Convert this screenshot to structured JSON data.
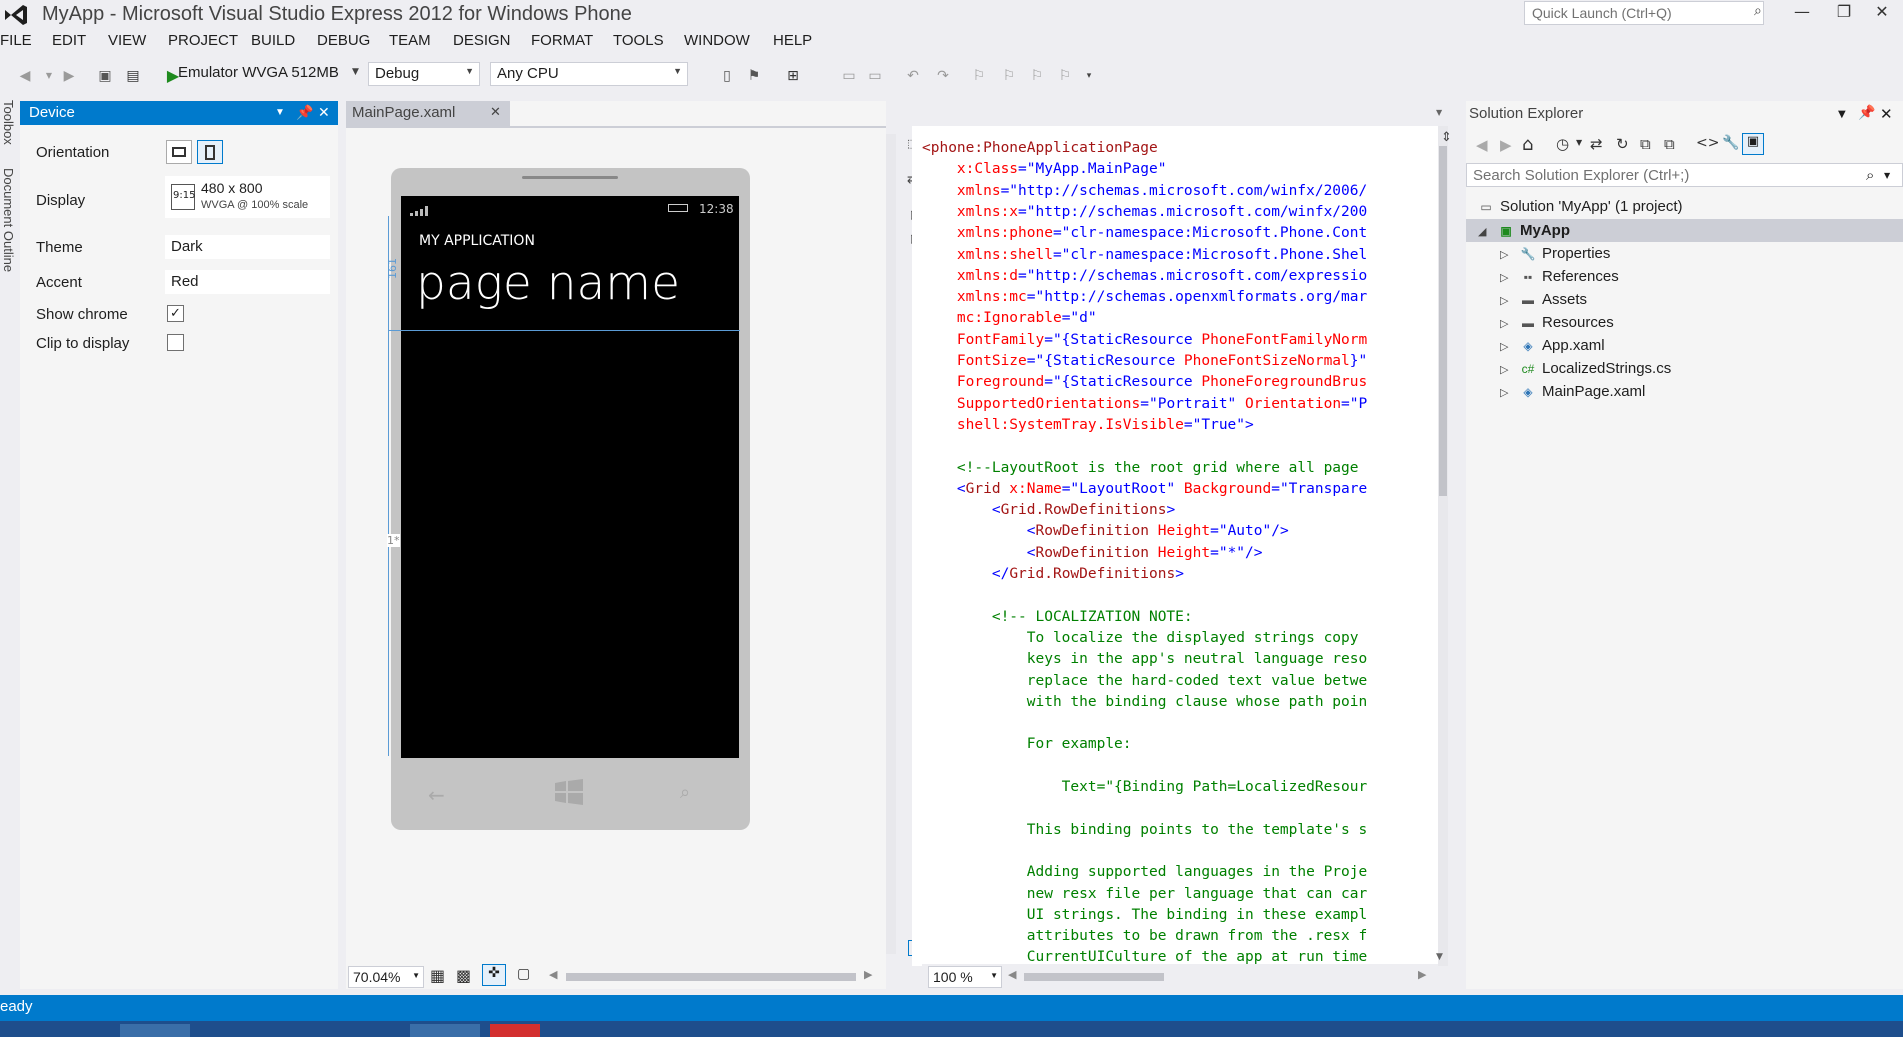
{
  "window": {
    "title": "MyApp - Microsoft Visual Studio Express 2012 for Windows Phone",
    "quick_launch_placeholder": "Quick Launch (Ctrl+Q)"
  },
  "menu": [
    "FILE",
    "EDIT",
    "VIEW",
    "PROJECT",
    "BUILD",
    "DEBUG",
    "TEAM",
    "DESIGN",
    "FORMAT",
    "TOOLS",
    "WINDOW",
    "HELP"
  ],
  "toolbar": {
    "run_target": "Emulator WVGA 512MB",
    "configuration": "Debug",
    "platform": "Any CPU"
  },
  "vertical_tabs": [
    "Toolbox",
    "Document Outline"
  ],
  "device_panel": {
    "title": "Device",
    "orientation_label": "Orientation",
    "display_label": "Display",
    "display_icon_text": "9:15",
    "display_value": "480 x 800",
    "display_sub": "WVGA @ 100% scale",
    "theme_label": "Theme",
    "theme_value": "Dark",
    "accent_label": "Accent",
    "accent_value": "Red",
    "show_chrome_label": "Show chrome",
    "show_chrome_checked": "✓",
    "clip_label": "Clip to display"
  },
  "designer": {
    "tab_label": "MainPage.xaml",
    "phone_time": "12:38",
    "app_name": "MY APPLICATION",
    "page_name": "page name",
    "row_marker_1": "161",
    "row_marker_2": "1*",
    "zoom": "70.04%"
  },
  "editor": {
    "zoom": "100 %",
    "lines": [
      [
        [
          "kw",
          "<phone:PhoneApplicationPage"
        ]
      ],
      [
        [
          "at",
          "    x:Class"
        ],
        [
          "vl",
          "=\"MyApp.MainPage\""
        ]
      ],
      [
        [
          "at",
          "    xmlns"
        ],
        [
          "vl",
          "=\"http://schemas.microsoft.com/winfx/2006/"
        ]
      ],
      [
        [
          "at",
          "    xmlns:x"
        ],
        [
          "vl",
          "=\"http://schemas.microsoft.com/winfx/200"
        ]
      ],
      [
        [
          "at",
          "    xmlns:phone"
        ],
        [
          "vl",
          "=\"clr-namespace:Microsoft.Phone.Cont"
        ]
      ],
      [
        [
          "at",
          "    xmlns:shell"
        ],
        [
          "vl",
          "=\"clr-namespace:Microsoft.Phone.Shel"
        ]
      ],
      [
        [
          "at",
          "    xmlns:d"
        ],
        [
          "vl",
          "=\"http://schemas.microsoft.com/expressio"
        ]
      ],
      [
        [
          "at",
          "    xmlns:mc"
        ],
        [
          "vl",
          "=\"http://schemas.openxmlformats.org/mar"
        ]
      ],
      [
        [
          "at",
          "    mc:Ignorable"
        ],
        [
          "vl",
          "=\"d\""
        ]
      ],
      [
        [
          "at",
          "    FontFamily"
        ],
        [
          "vl",
          "=\"{StaticResource "
        ],
        [
          "at",
          "PhoneFontFamilyNorm"
        ]
      ],
      [
        [
          "at",
          "    FontSize"
        ],
        [
          "vl",
          "=\"{StaticResource "
        ],
        [
          "at",
          "PhoneFontSizeNormal"
        ],
        [
          "vl",
          "}\""
        ]
      ],
      [
        [
          "at",
          "    Foreground"
        ],
        [
          "vl",
          "=\"{StaticResource "
        ],
        [
          "at",
          "PhoneForegroundBrus"
        ]
      ],
      [
        [
          "at",
          "    SupportedOrientations"
        ],
        [
          "vl",
          "=\"Portrait\" "
        ],
        [
          "at",
          "Orientation"
        ],
        [
          "vl",
          "=\"P"
        ]
      ],
      [
        [
          "at",
          "    shell:SystemTray.IsVisible"
        ],
        [
          "vl",
          "=\"True\">"
        ]
      ],
      [
        [
          "vl",
          ""
        ]
      ],
      [
        [
          "cm",
          "    <!--LayoutRoot is the root grid where all page"
        ]
      ],
      [
        [
          "vl",
          "    <"
        ],
        [
          "kw",
          "Grid"
        ],
        [
          "at",
          " x:Name"
        ],
        [
          "vl",
          "=\"LayoutRoot\" "
        ],
        [
          "at",
          "Background"
        ],
        [
          "vl",
          "=\"Transpare"
        ]
      ],
      [
        [
          "vl",
          "        <"
        ],
        [
          "kw",
          "Grid.RowDefinitions"
        ],
        [
          "vl",
          ">"
        ]
      ],
      [
        [
          "vl",
          "            <"
        ],
        [
          "kw",
          "RowDefinition"
        ],
        [
          "at",
          " Height"
        ],
        [
          "vl",
          "=\"Auto\"/>"
        ]
      ],
      [
        [
          "vl",
          "            <"
        ],
        [
          "kw",
          "RowDefinition"
        ],
        [
          "at",
          " Height"
        ],
        [
          "vl",
          "=\"*\"/>"
        ]
      ],
      [
        [
          "vl",
          "        </"
        ],
        [
          "kw",
          "Grid.RowDefinitions"
        ],
        [
          "vl",
          ">"
        ]
      ],
      [
        [
          "vl",
          ""
        ]
      ],
      [
        [
          "cm",
          "        <!-- LOCALIZATION NOTE:"
        ]
      ],
      [
        [
          "cm",
          "            To localize the displayed strings copy"
        ]
      ],
      [
        [
          "cm",
          "            keys in the app's neutral language reso"
        ]
      ],
      [
        [
          "cm",
          "            replace the hard-coded text value betwe"
        ]
      ],
      [
        [
          "cm",
          "            with the binding clause whose path poin"
        ]
      ],
      [
        [
          "vl",
          ""
        ]
      ],
      [
        [
          "cm",
          "            For example:"
        ]
      ],
      [
        [
          "vl",
          ""
        ]
      ],
      [
        [
          "cm",
          "                Text=\"{Binding Path=LocalizedResour"
        ]
      ],
      [
        [
          "vl",
          ""
        ]
      ],
      [
        [
          "cm",
          "            This binding points to the template's s"
        ]
      ],
      [
        [
          "vl",
          ""
        ]
      ],
      [
        [
          "cm",
          "            Adding supported languages in the Proje"
        ]
      ],
      [
        [
          "cm",
          "            new resx file per language that can car"
        ]
      ],
      [
        [
          "cm",
          "            UI strings. The binding in these exampl"
        ]
      ],
      [
        [
          "cm",
          "            attributes to be drawn from the .resx f"
        ]
      ],
      [
        [
          "cm",
          "            CurrentUICulture of the app at run time"
        ]
      ]
    ]
  },
  "solution_explorer": {
    "title": "Solution Explorer",
    "search_placeholder": "Search Solution Explorer (Ctrl+;)",
    "solution": "Solution 'MyApp' (1 project)",
    "project": "MyApp",
    "items": [
      "Properties",
      "References",
      "Assets",
      "Resources",
      "App.xaml",
      "LocalizedStrings.cs",
      "MainPage.xaml"
    ]
  },
  "status": {
    "text": "eady"
  },
  "colors": {
    "accent": "#007acc",
    "background": "#eeeef2"
  }
}
